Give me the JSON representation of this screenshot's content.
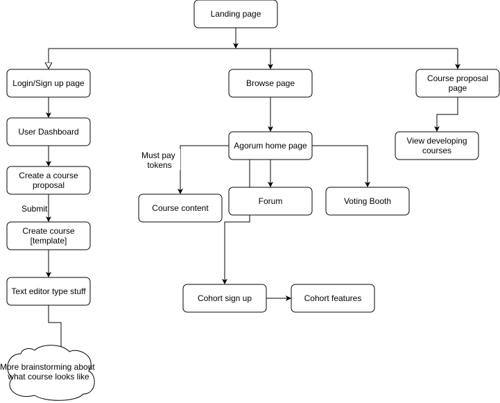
{
  "nodes": {
    "landing": [
      "Landing page"
    ],
    "login": [
      "Login/Sign up page"
    ],
    "browse": [
      "Browse page"
    ],
    "course_proposal": [
      "Course proposal",
      "page"
    ],
    "dashboard": [
      "User Dashboard"
    ],
    "create_proposal": [
      "Create a course",
      "proposal"
    ],
    "create_course": [
      "Create course",
      "[template]"
    ],
    "text_editor": [
      "Text editor type stuff"
    ],
    "brainstorm": [
      "More brainstorming about",
      "what course looks like"
    ],
    "agorum": [
      "Agorum home page"
    ],
    "course_content": [
      "Course content"
    ],
    "forum": [
      "Forum"
    ],
    "voting": [
      "Voting Booth"
    ],
    "view_developing": [
      "View developing",
      "courses"
    ],
    "cohort_signup": [
      "Cohort sign up"
    ],
    "cohort_features": [
      "Cohort features"
    ]
  },
  "edge_labels": {
    "must_pay": [
      "Must pay",
      "tokens"
    ],
    "submit": "Submit"
  }
}
